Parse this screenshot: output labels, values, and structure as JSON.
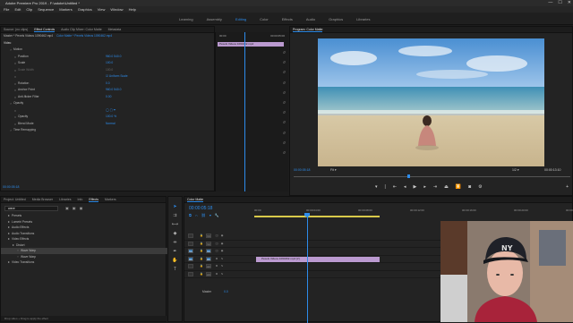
{
  "window": {
    "title": "Adobe Premiere Pro 2019 - F:\\adobe\\Untitled *",
    "controls": [
      "—",
      "☐",
      "✕"
    ]
  },
  "menu": [
    "File",
    "Edit",
    "Clip",
    "Sequence",
    "Markers",
    "Graphics",
    "View",
    "Window",
    "Help"
  ],
  "workspaces": [
    "Learning",
    "Assembly",
    "Editing",
    "Color",
    "Effects",
    "Audio",
    "Graphics",
    "Libraries"
  ],
  "workspace_active_index": 2,
  "source_panel": {
    "tabs": [
      "Source: (no clips)",
      "Effect Controls",
      "Audio Clip Mixer: Color Matte",
      "Metadata"
    ],
    "clip_path": "Master * Pexels Videos 1090462.mp4",
    "clip_link": "Color Matte * Pexels Videos 1090462.mp4",
    "section": "Video",
    "props": [
      {
        "name": "Motion",
        "value": "",
        "indent": 1,
        "dim": false
      },
      {
        "name": "Position",
        "value": "960.0   540.0",
        "indent": 2,
        "dim": false
      },
      {
        "name": "Scale",
        "value": "100.0",
        "indent": 2,
        "dim": false
      },
      {
        "name": "Scale Width",
        "value": "100.0",
        "indent": 2,
        "dim": true
      },
      {
        "name": "",
        "value": "☑ Uniform Scale",
        "indent": 2,
        "dim": false
      },
      {
        "name": "Rotation",
        "value": "0.0",
        "indent": 2,
        "dim": false
      },
      {
        "name": "Anchor Point",
        "value": "960.0   540.0",
        "indent": 2,
        "dim": false
      },
      {
        "name": "Anti-flicker Filter",
        "value": "0.00",
        "indent": 2,
        "dim": false
      },
      {
        "name": "Opacity",
        "value": "",
        "indent": 1,
        "dim": false
      },
      {
        "name": "",
        "value": "◯ ▢ ✒",
        "indent": 2,
        "dim": false
      },
      {
        "name": "Opacity",
        "value": "100.0 %",
        "indent": 2,
        "dim": false
      },
      {
        "name": "Blend Mode",
        "value": "Normal",
        "indent": 2,
        "dim": false
      },
      {
        "name": "Time Remapping",
        "value": "",
        "indent": 1,
        "dim": false
      }
    ],
    "mini_time": "00:00",
    "mini_time2": "00:00:05:00",
    "mini_clip": "Pexels Videos 1090462.mp4",
    "timecode": "00:00:05:18"
  },
  "program": {
    "title": "Program: Color Matte",
    "timecode": "00:00:05:18",
    "fit": "Fit",
    "quality": "1/2",
    "duration": "00:00:13:10"
  },
  "project_panel": {
    "tabs": [
      "Project: Untitled",
      "Media Browser",
      "Libraries",
      "Info",
      "Effects",
      "Markers"
    ],
    "search": "wave",
    "tree": [
      {
        "label": "Presets",
        "indent": 0,
        "selected": false
      },
      {
        "label": "Lumetri Presets",
        "indent": 0,
        "selected": false
      },
      {
        "label": "Audio Effects",
        "indent": 0,
        "selected": false
      },
      {
        "label": "Audio Transitions",
        "indent": 0,
        "selected": false
      },
      {
        "label": "Video Effects",
        "indent": 0,
        "selected": false
      },
      {
        "label": "Distort",
        "indent": 1,
        "selected": false
      },
      {
        "label": "Wave Warp",
        "indent": 2,
        "selected": true
      },
      {
        "label": "Wave Warp",
        "indent": 2,
        "selected": false
      },
      {
        "label": "Video Transitions",
        "indent": 0,
        "selected": false
      }
    ],
    "status": "Drop video + Drag to apply the effect"
  },
  "timeline": {
    "tab": "Color Matte",
    "timecode": "00:00:05:18",
    "ruler": [
      "00:00",
      "00:00:04:00",
      "00:00:08:00",
      "00:00:12:00",
      "00:00:16:00",
      "00:00:20:00",
      "00:00:24:00"
    ],
    "tracks": [
      "V3",
      "V2",
      "V1",
      "A1",
      "A2",
      "A3"
    ],
    "src_tracks": [
      "",
      "",
      "V1",
      "A1",
      "",
      ""
    ],
    "clip_label": "Pexels Videos 1090462.mp4 [V]",
    "master": "Master",
    "master_val": "0.0"
  },
  "colors": {
    "accent": "#2d8ceb",
    "clip": "#bb9ad0",
    "playhead": "#2d8ceb"
  },
  "icons": [
    "selection-tool-icon",
    "track-select-icon",
    "ripple-edit-icon",
    "razor-icon",
    "slip-icon",
    "pen-icon",
    "hand-icon",
    "type-icon",
    "play-icon",
    "step-back-icon",
    "step-forward-icon",
    "export-frame-icon",
    "settings-icon",
    "folder-icon"
  ]
}
